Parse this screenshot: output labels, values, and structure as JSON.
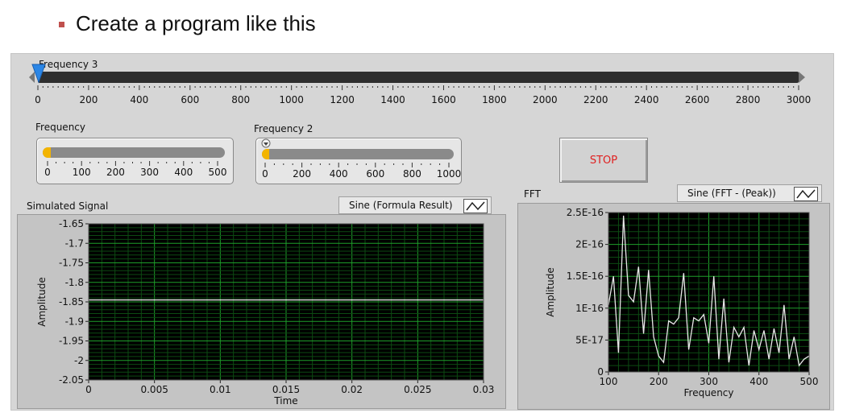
{
  "headline": "Create a program like this",
  "freq3": {
    "label": "Frequency 3",
    "ticks": [
      "0",
      "200",
      "400",
      "600",
      "800",
      "1000",
      "1200",
      "1400",
      "1600",
      "1800",
      "2000",
      "2200",
      "2400",
      "2600",
      "2800",
      "3000"
    ],
    "value": 0
  },
  "freq1": {
    "label": "Frequency",
    "ticks": [
      "0",
      "100",
      "200",
      "300",
      "400",
      "500"
    ],
    "value": 0
  },
  "freq2": {
    "label": "Frequency 2",
    "ticks": [
      "0",
      "200",
      "400",
      "600",
      "800",
      "1000"
    ],
    "value": 0
  },
  "stop": {
    "label": "STOP"
  },
  "sim": {
    "title": "Simulated Signal",
    "legend": "Sine (Formula Result)",
    "ylabel": "Amplitude",
    "xlabel": "Time"
  },
  "fft": {
    "title": "FFT",
    "legend": "Sine (FFT - (Peak))",
    "ylabel": "Amplitude",
    "xlabel": "Frequency"
  },
  "chart_data": [
    {
      "type": "line",
      "title": "Simulated Signal",
      "xlabel": "Time",
      "ylabel": "Amplitude",
      "xlim": [
        0,
        0.03
      ],
      "ylim": [
        -2.05,
        -1.65
      ],
      "xticks": [
        "0",
        "0.005",
        "0.01",
        "0.015",
        "0.02",
        "0.025",
        "0.03"
      ],
      "yticks": [
        "-1.65",
        "-1.7",
        "-1.75",
        "-1.8",
        "-1.85",
        "-1.9",
        "-1.95",
        "-2",
        "-2.05"
      ],
      "grid": true,
      "series": [
        {
          "name": "Sine (Formula Result)",
          "x": [
            0,
            0.03
          ],
          "y": [
            -1.845,
            -1.845
          ],
          "color": "#e8e8e8"
        }
      ]
    },
    {
      "type": "line",
      "title": "FFT",
      "xlabel": "Frequency",
      "ylabel": "Amplitude",
      "xlim": [
        100,
        500
      ],
      "ylim": [
        0,
        2.5e-16
      ],
      "xticks": [
        "100",
        "200",
        "300",
        "400",
        "500"
      ],
      "yticks": [
        "2.5E-16",
        "2E-16",
        "1.5E-16",
        "1E-16",
        "5E-17",
        "0"
      ],
      "grid": true,
      "series": [
        {
          "name": "Sine (FFT - (Peak))",
          "color": "#e8e8e8",
          "x": [
            100,
            110,
            120,
            130,
            140,
            150,
            160,
            170,
            180,
            190,
            200,
            210,
            220,
            230,
            240,
            250,
            260,
            270,
            280,
            290,
            300,
            310,
            320,
            330,
            340,
            350,
            360,
            370,
            380,
            390,
            400,
            410,
            420,
            430,
            440,
            450,
            460,
            470,
            480,
            490,
            500
          ],
          "y": [
            1.05e-16,
            1.5e-16,
            3e-17,
            2.45e-16,
            1.2e-16,
            1.1e-16,
            1.65e-16,
            6e-17,
            1.6e-16,
            5.5e-17,
            2.5e-17,
            1.5e-17,
            8e-17,
            7.5e-17,
            8.5e-17,
            1.55e-16,
            3.5e-17,
            8.5e-17,
            8e-17,
            9e-17,
            4.5e-17,
            1.5e-16,
            2e-17,
            1.15e-16,
            1.5e-17,
            7e-17,
            5.5e-17,
            7e-17,
            1e-17,
            6.5e-17,
            3.5e-17,
            6.5e-17,
            2e-17,
            6.8e-17,
            3e-17,
            1.05e-16,
            2e-17,
            5.5e-17,
            1e-17,
            2e-17,
            2.5e-17
          ]
        }
      ]
    }
  ]
}
